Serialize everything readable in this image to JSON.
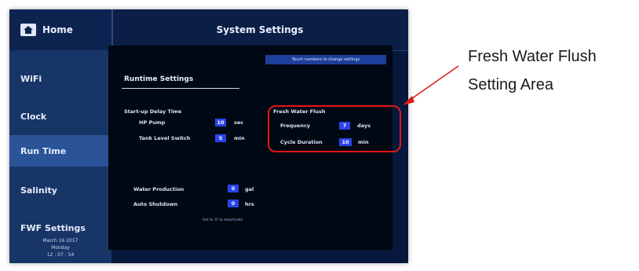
{
  "header": {
    "home_label": "Home",
    "title": "System Settings"
  },
  "sidebar": {
    "items": [
      {
        "label": "WiFi"
      },
      {
        "label": "Clock"
      },
      {
        "label": "Run Time",
        "active": true
      },
      {
        "label": "Salinity"
      },
      {
        "label": "FWF Settings"
      }
    ],
    "date_line1": "March   16  2017",
    "date_line2": "Monday",
    "time": "12 : 07 : 54"
  },
  "main": {
    "hint": "Touch numbers to change settings",
    "section_title": "Runtime Settings",
    "startup": {
      "heading": "Start-up Delay Time",
      "hp_pump": {
        "label": "HP Pump",
        "value": "10",
        "unit": "sec"
      },
      "tank_switch": {
        "label": "Tank Level Switch",
        "value": "5",
        "unit": "min"
      }
    },
    "fwf": {
      "heading": "Fresh Water Flush",
      "frequency": {
        "label": "Frequency",
        "value": "7",
        "unit": "days"
      },
      "cycle": {
        "label": "Cycle Duration",
        "value": "10",
        "unit": "min"
      }
    },
    "production": {
      "water": {
        "label": "Water Production",
        "value": "0",
        "unit": "gal"
      },
      "auto": {
        "label": "Auto Shutdown",
        "value": "0",
        "unit": "hrs"
      },
      "reset_note": "Set to '0' to deactivate"
    }
  },
  "annotation": {
    "line1": "Fresh Water Flush",
    "line2": "Setting Area"
  },
  "colors": {
    "highlight": "#e01818",
    "value_box": "#2a44e8",
    "screen_bg": "#06183b"
  }
}
